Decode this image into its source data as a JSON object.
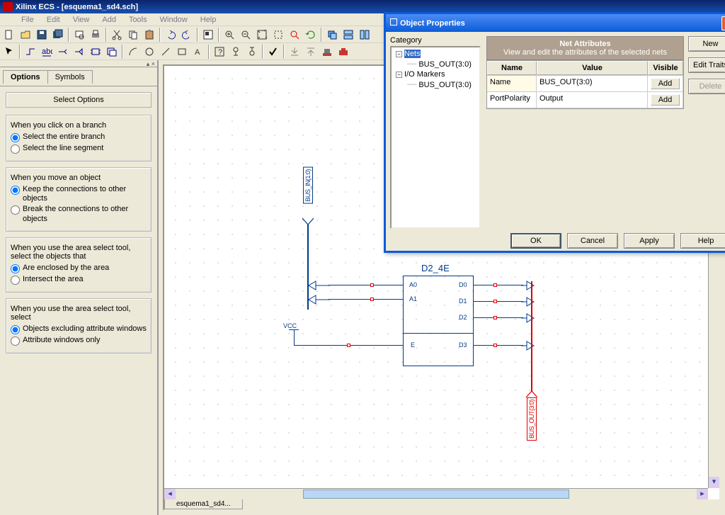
{
  "window": {
    "title": "Xilinx ECS - [esquema1_sd4.sch]"
  },
  "menu": [
    "File",
    "Edit",
    "View",
    "Add",
    "Tools",
    "Window",
    "Help"
  ],
  "left_panel": {
    "tabs": [
      "Options",
      "Symbols"
    ],
    "active_tab": "Options",
    "header": "Select Options",
    "group1": {
      "title": "When you click on a branch",
      "opt1": "Select the entire branch",
      "opt2": "Select the line segment"
    },
    "group2": {
      "title": "When you move an object",
      "opt1": "Keep the connections to other objects",
      "opt2": "Break the connections to other objects"
    },
    "group3": {
      "title": "When you use the area select tool, select the objects that",
      "opt1": "Are enclosed by the area",
      "opt2": "Intersect the area"
    },
    "group4": {
      "title": "When you use the area select tool, select",
      "opt1": "Objects excluding attribute windows",
      "opt2": "Attribute windows only"
    }
  },
  "canvas": {
    "component": "D2_4E",
    "vcc": "VCC",
    "pins_left": [
      "A0",
      "A1",
      "E"
    ],
    "pins_right": [
      "D0",
      "D1",
      "D2",
      "D3"
    ],
    "bus_in": "BUS_IN(1:0)",
    "bus_out": "BUS_OUT(3:0)"
  },
  "doc_tab": "esquema1_sd4...",
  "dialog": {
    "title": "Object Properties",
    "category_label": "Category",
    "tree": {
      "nets": "Nets",
      "nets_child": "BUS_OUT(3:0)",
      "io": "I/O Markers",
      "io_child": "BUS_OUT(3:0)"
    },
    "attr_header1": "Net Attributes",
    "attr_header2": "View and edit the attributes of the selected nets",
    "grid": {
      "h_name": "Name",
      "h_value": "Value",
      "h_visible": "Visible",
      "r1_name": "Name",
      "r1_value": "BUS_OUT(3:0)",
      "r1_vis": "Add",
      "r2_name": "PortPolarity",
      "r2_value": "Output",
      "r2_vis": "Add"
    },
    "buttons": {
      "new": "New",
      "edit_traits": "Edit Traits",
      "delete": "Delete",
      "ok": "OK",
      "cancel": "Cancel",
      "apply": "Apply",
      "help": "Help"
    }
  }
}
